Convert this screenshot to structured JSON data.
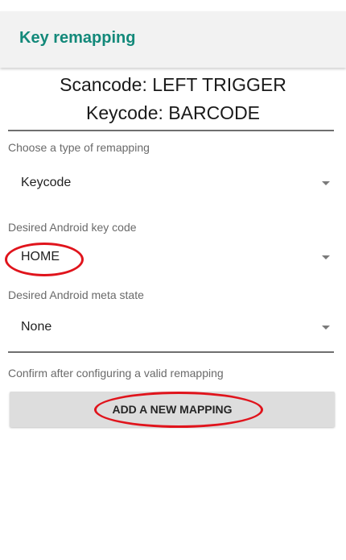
{
  "app": {
    "title": "Key remapping"
  },
  "header": {
    "scancode_line": "Scancode: LEFT TRIGGER",
    "keycode_line": "Keycode: BARCODE"
  },
  "remap_type": {
    "label": "Choose a type of remapping",
    "value": "Keycode"
  },
  "key_code": {
    "label": "Desired Android key code",
    "value": "HOME"
  },
  "meta_state": {
    "label": "Desired Android meta state",
    "value": "None"
  },
  "confirm": {
    "label": "Confirm after configuring a valid remapping",
    "button_label": "ADD A NEW MAPPING"
  },
  "colors": {
    "accent": "#13897a",
    "highlight_circle": "#e0141c",
    "button_bg": "#dddddd"
  },
  "icons": {
    "spinner_arrow": "dropdown-arrow-icon"
  }
}
